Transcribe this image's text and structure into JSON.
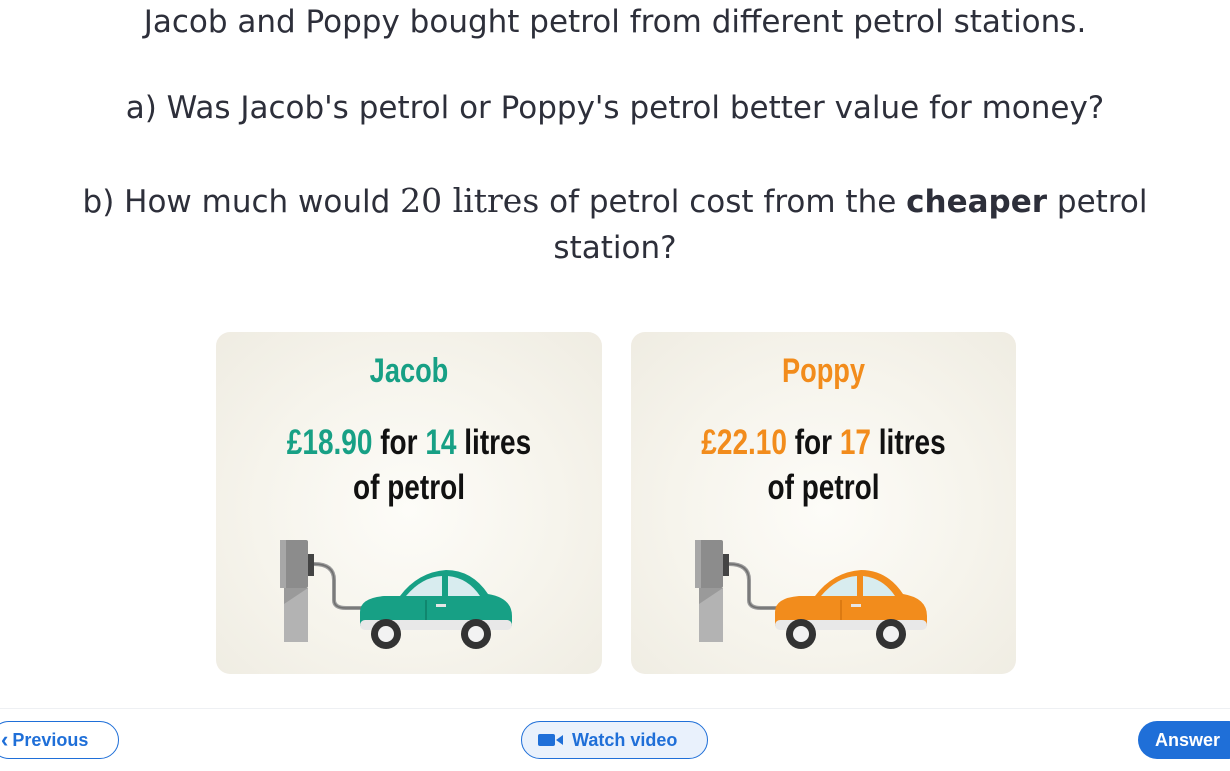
{
  "question": {
    "intro": "Jacob and Poppy bought petrol from different petrol stations.",
    "part_a": "a) Was Jacob's petrol or Poppy's petrol better value for money?",
    "part_b_prefix": "b) How much would ",
    "part_b_number": "20",
    "part_b_unit": " litres",
    "part_b_middle": " of petrol cost from the ",
    "part_b_emphasis": "cheaper",
    "part_b_suffix": " petrol station?"
  },
  "cards": {
    "jacob": {
      "name": "Jacob",
      "price": "£18.90",
      "for_word": " for ",
      "litres_value": "14",
      "litres_word": " litres",
      "line2": "of petrol",
      "accent": "#17a085"
    },
    "poppy": {
      "name": "Poppy",
      "price": "£22.10",
      "for_word": " for ",
      "litres_value": "17",
      "litres_word": " litres",
      "line2": "of petrol",
      "accent": "#f28c1c"
    }
  },
  "nav": {
    "previous_label": "Previous",
    "previous_icon": "chevron-left-icon",
    "video_label": "Watch video",
    "video_icon": "video-camera-icon",
    "answer_label": "Answer",
    "accent_color": "#1f6fd8"
  }
}
